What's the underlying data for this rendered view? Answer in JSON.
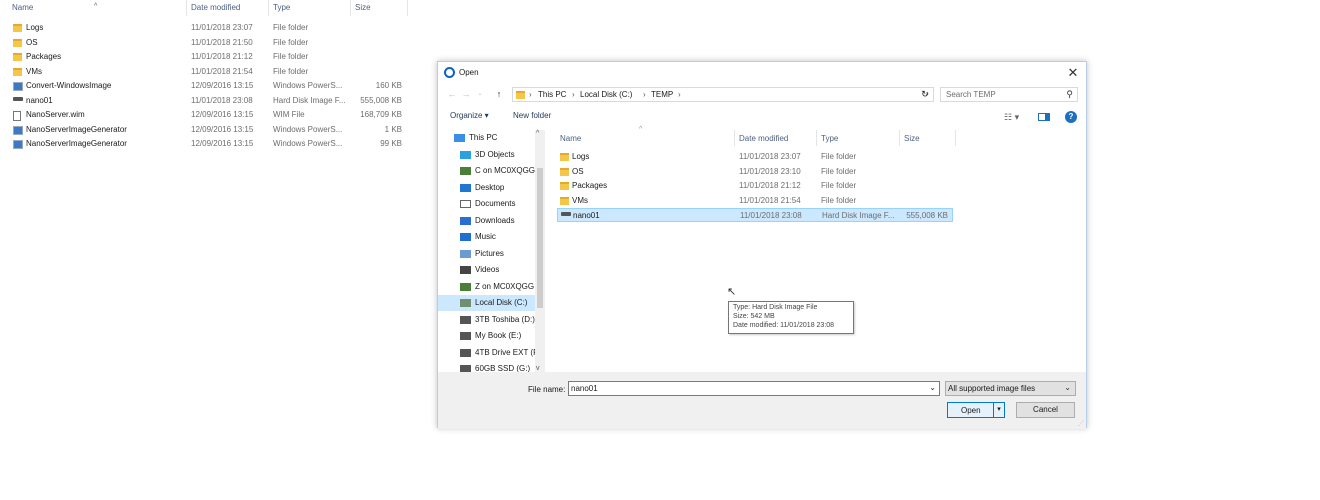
{
  "background_explorer": {
    "columns": {
      "name": "Name",
      "date": "Date modified",
      "type": "Type",
      "size": "Size"
    },
    "rows": [
      {
        "icon": "folder-icon",
        "name": "Logs",
        "date": "11/01/2018 23:07",
        "type": "File folder",
        "size": ""
      },
      {
        "icon": "folder-icon",
        "name": "OS",
        "date": "11/01/2018 21:50",
        "type": "File folder",
        "size": ""
      },
      {
        "icon": "folder-icon",
        "name": "Packages",
        "date": "11/01/2018 21:12",
        "type": "File folder",
        "size": ""
      },
      {
        "icon": "folder-icon",
        "name": "VMs",
        "date": "11/01/2018 21:54",
        "type": "File folder",
        "size": ""
      },
      {
        "icon": "powershell-icon",
        "name": "Convert-WindowsImage",
        "date": "12/09/2016 13:15",
        "type": "Windows PowerS...",
        "size": "160 KB"
      },
      {
        "icon": "drive-icon",
        "name": "nano01",
        "date": "11/01/2018 23:08",
        "type": "Hard Disk Image F...",
        "size": "555,008 KB"
      },
      {
        "icon": "file-icon",
        "name": "NanoServer.wim",
        "date": "12/09/2016 13:15",
        "type": "WIM File",
        "size": "168,709 KB"
      },
      {
        "icon": "powershell-icon",
        "name": "NanoServerImageGenerator",
        "date": "12/09/2016 13:15",
        "type": "Windows PowerS...",
        "size": "1 KB"
      },
      {
        "icon": "powershell-icon",
        "name": "NanoServerImageGenerator",
        "date": "12/09/2016 13:15",
        "type": "Windows PowerS...",
        "size": "99 KB"
      }
    ]
  },
  "dialog": {
    "title": "Open",
    "close_label": "✕",
    "address": {
      "crumbs": [
        "This PC",
        "Local Disk (C:)",
        "TEMP"
      ],
      "sep": "›"
    },
    "search_placeholder": "Search TEMP",
    "toolbar": {
      "organize": "Organize ▾",
      "new_folder": "New folder"
    },
    "nav": [
      {
        "label": "This PC",
        "icon": "pc-icon",
        "top": true
      },
      {
        "label": "3D Objects",
        "icon": "3d-objects-icon"
      },
      {
        "label": "C on MC0XQGG",
        "icon": "network-drive-icon"
      },
      {
        "label": "Desktop",
        "icon": "desktop-icon"
      },
      {
        "label": "Documents",
        "icon": "documents-icon"
      },
      {
        "label": "Downloads",
        "icon": "downloads-icon"
      },
      {
        "label": "Music",
        "icon": "music-icon"
      },
      {
        "label": "Pictures",
        "icon": "pictures-icon"
      },
      {
        "label": "Videos",
        "icon": "videos-icon"
      },
      {
        "label": "Z on MC0XQGG",
        "icon": "network-drive-icon"
      },
      {
        "label": "Local Disk (C:)",
        "icon": "local-disk-icon",
        "selected": true
      },
      {
        "label": "3TB Toshiba (D:)",
        "icon": "drive-icon"
      },
      {
        "label": "My Book (E:)",
        "icon": "drive-icon"
      },
      {
        "label": "4TB Drive EXT (F",
        "icon": "drive-icon"
      },
      {
        "label": "60GB SSD (G:)",
        "icon": "drive-icon"
      }
    ],
    "columns": {
      "name": "Name",
      "date": "Date modified",
      "type": "Type",
      "size": "Size"
    },
    "files": [
      {
        "icon": "folder-icon",
        "name": "Logs",
        "date": "11/01/2018 23:07",
        "type": "File folder",
        "size": ""
      },
      {
        "icon": "folder-icon",
        "name": "OS",
        "date": "11/01/2018 23:10",
        "type": "File folder",
        "size": ""
      },
      {
        "icon": "folder-icon",
        "name": "Packages",
        "date": "11/01/2018 21:12",
        "type": "File folder",
        "size": ""
      },
      {
        "icon": "folder-icon",
        "name": "VMs",
        "date": "11/01/2018 21:54",
        "type": "File folder",
        "size": ""
      },
      {
        "icon": "drive-icon",
        "name": "nano01",
        "date": "11/01/2018 23:08",
        "type": "Hard Disk Image F...",
        "size": "555,008 KB",
        "selected": true
      }
    ],
    "tooltip": {
      "line1": "Type: Hard Disk Image File",
      "line2": "Size: 542 MB",
      "line3": "Date modified: 11/01/2018 23:08"
    },
    "filename_label": "File name:",
    "filename_value": "nano01",
    "filetype_value": "All supported image files",
    "open_label": "Open",
    "cancel_label": "Cancel"
  }
}
